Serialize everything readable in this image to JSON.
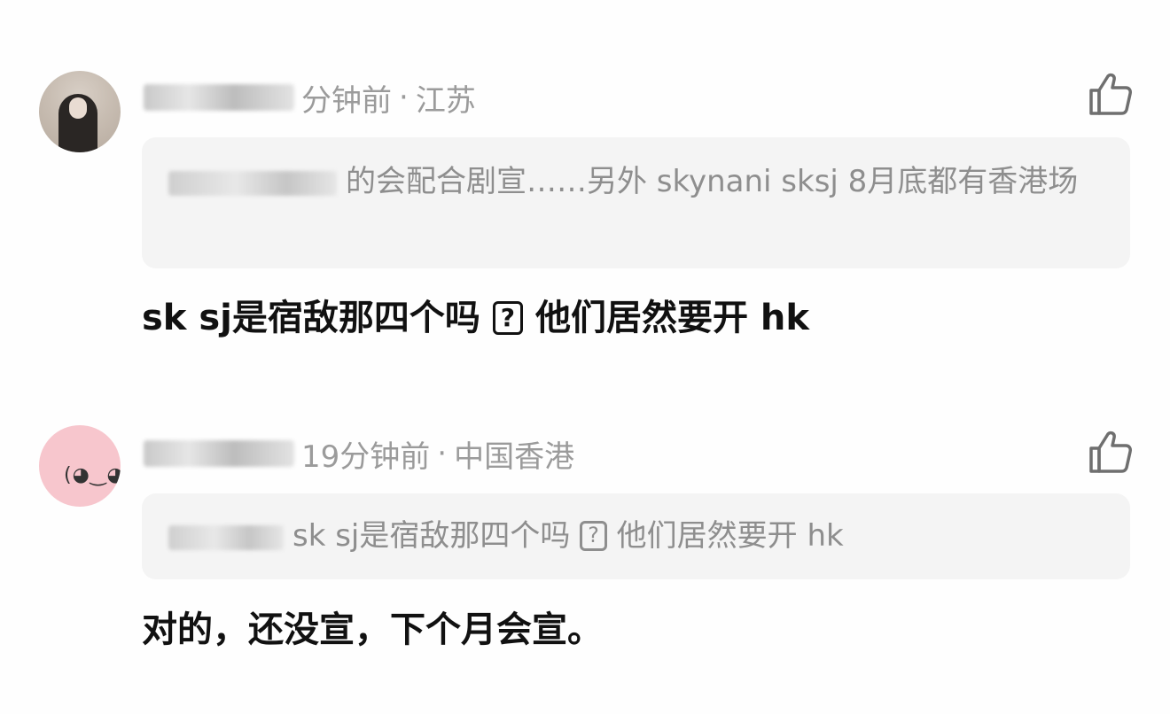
{
  "comments": [
    {
      "meta": {
        "time": "分钟前",
        "separator": "·",
        "location": "江苏"
      },
      "quote": {
        "text": "的会配合剧宣……另外 skynani sksj 8月底都有香港场"
      },
      "body": {
        "text_before": "sk sj是宿敌那四个吗",
        "qmark": "?",
        "text_after": "他们居然要开 hk"
      }
    },
    {
      "meta": {
        "time": "19分钟前",
        "separator": "·",
        "location": "中国香港"
      },
      "quote": {
        "text_before": "sk sj是宿敌那四个吗",
        "qmark": "?",
        "text_after": "他们居然要开 hk"
      },
      "body": {
        "text": "对的，还没宣，下个月会宣。"
      }
    }
  ],
  "icons": {
    "like": "thumbs-up-icon"
  },
  "colors": {
    "meta_text": "#9b9b9b",
    "quote_bg": "#f4f4f4",
    "body_text": "#111111",
    "avatar2_bg": "#f7c6cd"
  }
}
